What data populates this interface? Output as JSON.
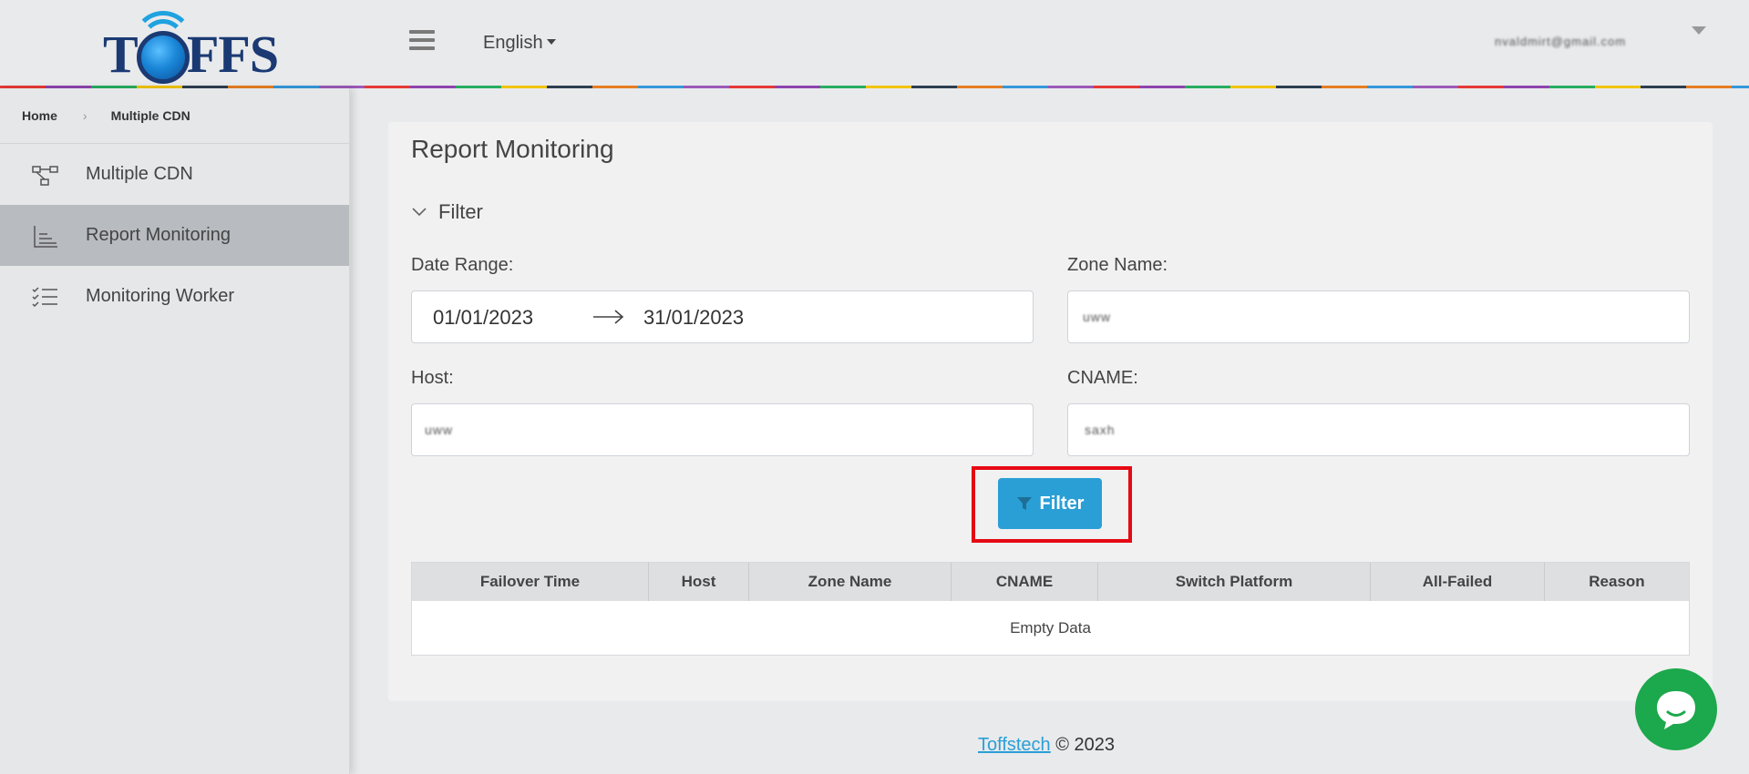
{
  "header": {
    "logo_text_left": "T",
    "logo_text_right": "FFS",
    "language": "English",
    "user_email": "nvaldmirt@gmail.com",
    "colors": {
      "brand_navy": "#1b3a73",
      "brand_blue": "#1fa2e0"
    }
  },
  "sidebar": {
    "breadcrumb": {
      "home": "Home",
      "current": "Multiple CDN"
    },
    "items": [
      {
        "label": "Multiple CDN",
        "icon": "network-icon",
        "active": false
      },
      {
        "label": "Report Monitoring",
        "icon": "chart-icon",
        "active": true
      },
      {
        "label": "Monitoring Worker",
        "icon": "checklist-icon",
        "active": false
      }
    ]
  },
  "main": {
    "title": "Report Monitoring",
    "filter_section": "Filter",
    "date_range": {
      "label": "Date Range:",
      "start": "01/01/2023",
      "end": "31/01/2023"
    },
    "zone_name": {
      "label": "Zone Name:",
      "value": "uww"
    },
    "host": {
      "label": "Host:",
      "value": "uww"
    },
    "cname": {
      "label": "CNAME:",
      "value": "saxh"
    },
    "filter_button": "Filter",
    "table": {
      "columns": [
        "Failover Time",
        "Host",
        "Zone Name",
        "CNAME",
        "Switch Platform",
        "All-Failed",
        "Reason"
      ],
      "empty_text": "Empty Data"
    },
    "accent_color": "#2a9fd6",
    "highlight_color": "#e50914"
  },
  "footer": {
    "link": "Toffstech",
    "text": "© 2023"
  }
}
